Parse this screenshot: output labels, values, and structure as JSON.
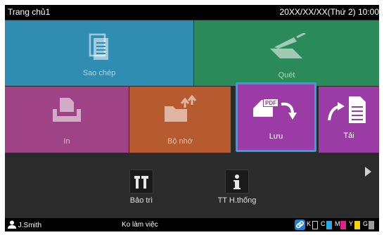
{
  "topbar": {
    "title": "Trang chủ1",
    "datetime": "20XX/XX/XX(Thứ 2) 10:00"
  },
  "tiles": {
    "copy": "Sao chép",
    "scan": "Quét",
    "print": "In",
    "storage": "Bộ nhớ",
    "save": "Lưu",
    "load": "Tải"
  },
  "menu": {
    "maintenance": "Bảo trì",
    "system_info": "TT H.thống"
  },
  "statusbar": {
    "user": "J.Smith",
    "status": "Ko làm việc",
    "inks": [
      {
        "label": "K",
        "color": "#000000"
      },
      {
        "label": "C",
        "color": "#29abe2"
      },
      {
        "label": "M",
        "color": "#e0218a"
      },
      {
        "label": "Y",
        "color": "#f5d400"
      },
      {
        "label": "G",
        "color": "#9a9a9a"
      }
    ]
  },
  "colors": {
    "copy_tile": "#2f8db1",
    "scan_tile": "#2a8a59",
    "print_tile": "#9f4387",
    "storage_tile": "#b55b2f",
    "save_tile": "#9b3ba6",
    "selection": "#2aa3de"
  },
  "icons": [
    "document-stack-icon",
    "scanner-icon",
    "print-tray-icon",
    "folder-upload-icon",
    "pdf-save-icon",
    "document-load-icon",
    "tools-icon",
    "info-icon",
    "user-icon",
    "link-icon",
    "next-page-icon"
  ]
}
